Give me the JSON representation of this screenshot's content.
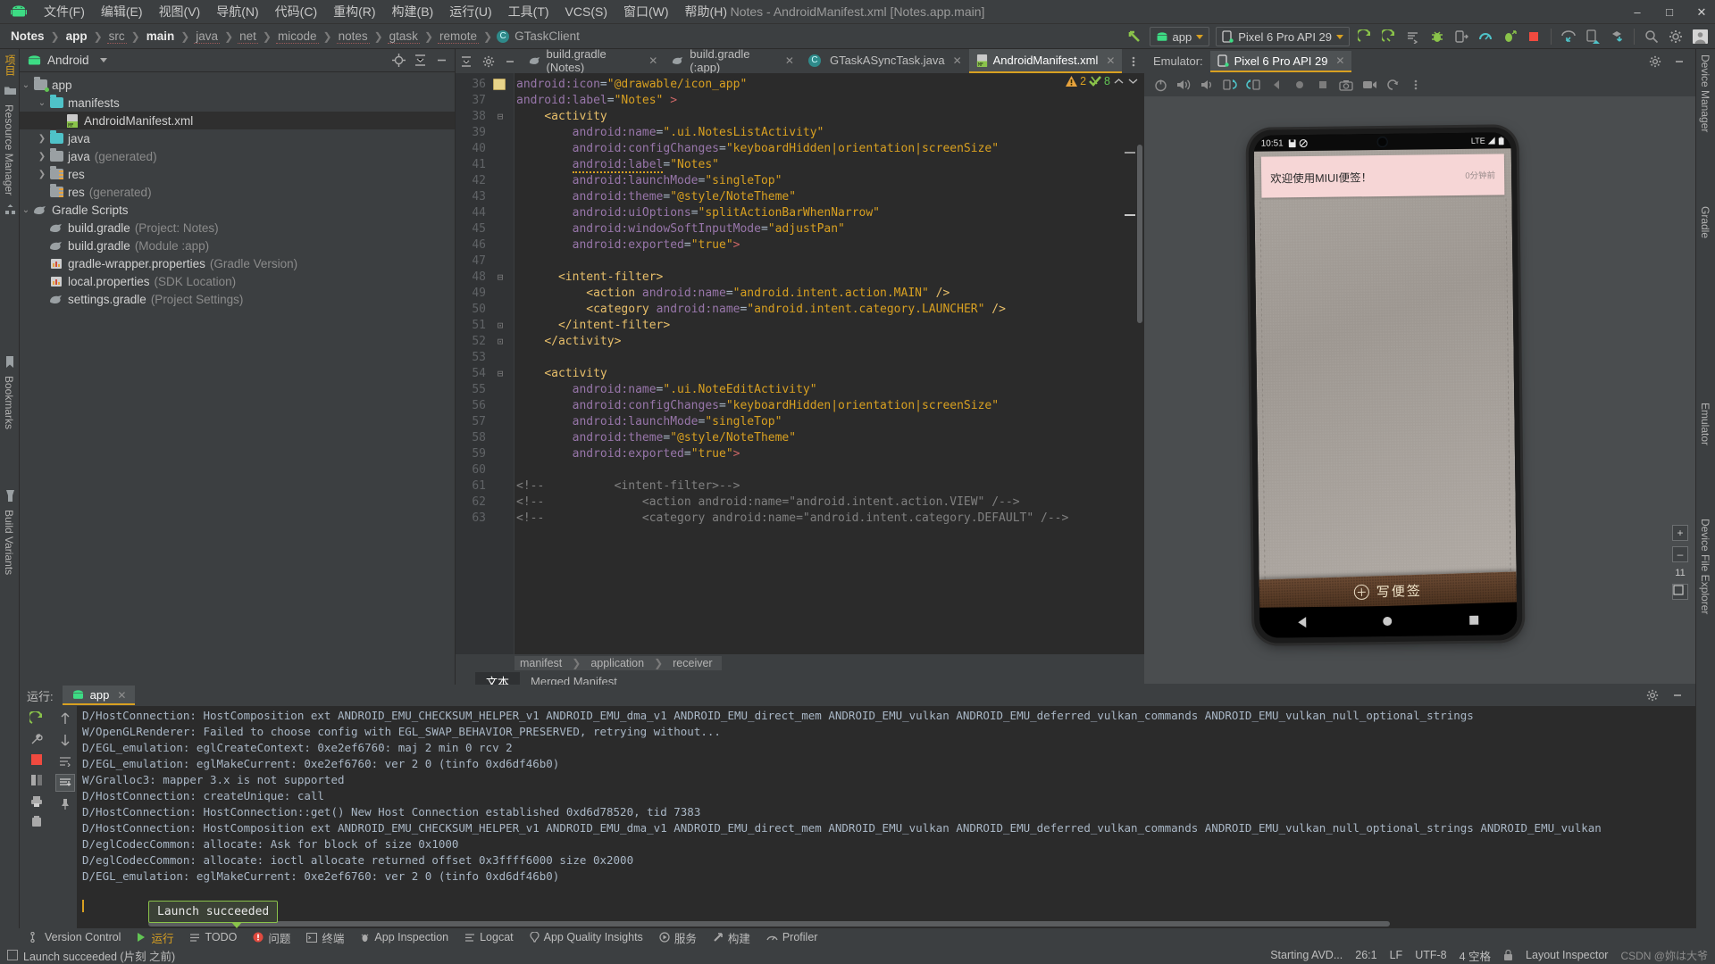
{
  "window": {
    "title": "Notes - AndroidManifest.xml [Notes.app.main]",
    "minimize": "–",
    "maximize": "□",
    "close": "✕"
  },
  "menubar": {
    "logo_icon": "android-logo-icon",
    "items": [
      "文件(F)",
      "编辑(E)",
      "视图(V)",
      "导航(N)",
      "代码(C)",
      "重构(R)",
      "构建(B)",
      "运行(U)",
      "工具(T)",
      "VCS(S)",
      "窗口(W)",
      "帮助(H)"
    ]
  },
  "navbar": {
    "crumbs": [
      {
        "label": "Notes",
        "bold": true
      },
      {
        "label": "app",
        "bold": true
      },
      {
        "label": "src",
        "bold": false
      },
      {
        "label": "main",
        "bold": true
      },
      {
        "label": "java",
        "bold": false
      },
      {
        "label": "net",
        "bold": false
      },
      {
        "label": "micode",
        "bold": false
      },
      {
        "label": "notes",
        "bold": false
      },
      {
        "label": "gtask",
        "bold": false
      },
      {
        "label": "remote",
        "bold": false
      }
    ],
    "final_crumb": "GTaskClient",
    "final_crumb_icon": "class-icon",
    "run_config": "app",
    "device_target": "Pixel 6 Pro API 29",
    "icons": [
      "build-arrow-icon",
      "run-icon",
      "run-coverage-icon",
      "attach-debugger-icon",
      "debug-icon",
      "profile-icon",
      "android-profiler-icon",
      "apply-changes-icon",
      "stop-icon",
      "device-manager-icon",
      "layout-inspector-icon",
      "sdk-download-icon",
      "search-icon",
      "settings-gear-icon",
      "account-avatar-icon"
    ]
  },
  "left_strip": {
    "tabs": [
      "项目",
      "Resource Manager"
    ],
    "icons": [
      "project-folder-icon",
      "resource-manager-icon",
      "structure-icon"
    ],
    "bottom_tabs": [
      "Bookmarks",
      "Build Variants"
    ]
  },
  "right_strip": {
    "tabs": [
      "Device Manager",
      "Gradle",
      "Emulator",
      "Device File Explorer"
    ]
  },
  "project_panel": {
    "title": "Android",
    "title_icon": "android-head-icon",
    "actions": [
      "locate-target-icon",
      "collapse-all-icon",
      "hide-icon"
    ],
    "tree": [
      {
        "depth": 0,
        "arrow": "open",
        "icon": "module-folder-icon",
        "label": "app",
        "sub": "",
        "selected": false
      },
      {
        "depth": 1,
        "arrow": "open",
        "icon": "folder-icon",
        "label": "manifests",
        "sub": "",
        "selected": false
      },
      {
        "depth": 2,
        "arrow": "none",
        "icon": "manifest-file-icon",
        "label": "AndroidManifest.xml",
        "sub": "",
        "selected": true
      },
      {
        "depth": 1,
        "arrow": "closed",
        "icon": "folder-icon",
        "label": "java",
        "sub": "",
        "selected": false
      },
      {
        "depth": 1,
        "arrow": "closed",
        "icon": "generated-folder-icon",
        "label": "java",
        "sub": "(generated)",
        "selected": false
      },
      {
        "depth": 1,
        "arrow": "closed",
        "icon": "res-folder-icon",
        "label": "res",
        "sub": "",
        "selected": false
      },
      {
        "depth": 1,
        "arrow": "none",
        "icon": "res-folder-icon",
        "label": "res",
        "sub": "(generated)",
        "selected": false
      },
      {
        "depth": 0,
        "arrow": "open",
        "icon": "gradle-icon",
        "label": "Gradle Scripts",
        "sub": "",
        "selected": false
      },
      {
        "depth": 1,
        "arrow": "none",
        "icon": "gradle-icon",
        "label": "build.gradle",
        "sub": "(Project: Notes)",
        "selected": false
      },
      {
        "depth": 1,
        "arrow": "none",
        "icon": "gradle-icon",
        "label": "build.gradle",
        "sub": "(Module :app)",
        "selected": false
      },
      {
        "depth": 1,
        "arrow": "none",
        "icon": "properties-icon",
        "label": "gradle-wrapper.properties",
        "sub": "(Gradle Version)",
        "selected": false
      },
      {
        "depth": 1,
        "arrow": "none",
        "icon": "properties-icon",
        "label": "local.properties",
        "sub": "(SDK Location)",
        "selected": false
      },
      {
        "depth": 1,
        "arrow": "none",
        "icon": "gradle-icon",
        "label": "settings.gradle",
        "sub": "(Project Settings)",
        "selected": false
      }
    ]
  },
  "editor": {
    "tools": [
      "collapse-icon",
      "settings-gear-icon",
      "hide-icon"
    ],
    "tabs": [
      {
        "label": "build.gradle (Notes)",
        "icon": "gradle-icon",
        "active": false,
        "closable": true
      },
      {
        "label": "build.gradle (:app)",
        "icon": "gradle-icon",
        "active": false,
        "closable": true
      },
      {
        "label": "GTaskASyncTask.java",
        "icon": "class-icon",
        "active": false,
        "closable": true
      },
      {
        "label": "AndroidManifest.xml",
        "icon": "manifest-file-icon",
        "active": true,
        "closable": true
      }
    ],
    "inspections": {
      "warning_count": "2",
      "ok_count": "8",
      "warning_icon": "warning-triangle-icon",
      "ok_icon": "inspection-ok-icon",
      "up_icon": "chevron-up-icon",
      "down_icon": "chevron-down-icon"
    },
    "lines": [
      {
        "num": "36",
        "fold": "",
        "bookmark": true,
        "html": "        <span class='k-attr'>android:icon</span><span class='k-eq'>=</span><span class='k-str'>\"@drawable/icon_app\"</span>"
      },
      {
        "num": "37",
        "fold": "",
        "html": "        <span class='k-attr'>android:label</span><span class='k-eq'>=</span><span class='k-str'>\"Notes\"</span> <span class='k-red'>&gt;</span>"
      },
      {
        "num": "38",
        "fold": "minus",
        "html": "    <span class='k-tagname'>&lt;activity</span>"
      },
      {
        "num": "39",
        "fold": "",
        "html": "        <span class='k-attr'>android:name</span><span class='k-eq'>=</span><span class='k-str'>\".ui.NotesListActivity\"</span>"
      },
      {
        "num": "40",
        "fold": "",
        "html": "        <span class='k-attr'>android:configChanges</span><span class='k-eq'>=</span><span class='k-str'>\"keyboardHidden|orientation|screenSize\"</span>"
      },
      {
        "num": "41",
        "fold": "",
        "html": "        <span class='k-attr squiggle'>android:label</span><span class='k-eq'>=</span><span class='k-str'>\"Notes\"</span>"
      },
      {
        "num": "42",
        "fold": "",
        "html": "        <span class='k-attr'>android:launchMode</span><span class='k-eq'>=</span><span class='k-str'>\"singleTop\"</span>"
      },
      {
        "num": "43",
        "fold": "",
        "html": "        <span class='k-attr'>android:theme</span><span class='k-eq'>=</span><span class='k-str'>\"@style/NoteTheme\"</span>"
      },
      {
        "num": "44",
        "fold": "",
        "html": "        <span class='k-attr'>android:uiOptions</span><span class='k-eq'>=</span><span class='k-str'>\"splitActionBarWhenNarrow\"</span>"
      },
      {
        "num": "45",
        "fold": "",
        "html": "        <span class='k-attr'>android:windowSoftInputMode</span><span class='k-eq'>=</span><span class='k-str'>\"adjustPan\"</span>"
      },
      {
        "num": "46",
        "fold": "",
        "html": "        <span class='k-attr'>android:exported</span><span class='k-eq'>=</span><span class='k-str'>\"true\"</span><span class='k-red'>&gt;</span>"
      },
      {
        "num": "47",
        "fold": "",
        "html": ""
      },
      {
        "num": "48",
        "fold": "minus",
        "html": "      <span class='k-tagname'>&lt;intent-filter&gt;</span>"
      },
      {
        "num": "49",
        "fold": "",
        "html": "          <span class='k-tagname'>&lt;action</span> <span class='k-attr'>android:name</span><span class='k-eq'>=</span><span class='k-str'>\"android.intent.action.MAIN\"</span> <span class='k-tagname'>/&gt;</span>"
      },
      {
        "num": "50",
        "fold": "",
        "html": "          <span class='k-tagname'>&lt;category</span> <span class='k-attr'>android:name</span><span class='k-eq'>=</span><span class='k-str'>\"android.intent.category.LAUNCHER\"</span> <span class='k-tagname'>/&gt;</span>"
      },
      {
        "num": "51",
        "fold": "plus",
        "html": "      <span class='k-tagname'>&lt;/intent-filter&gt;</span>"
      },
      {
        "num": "52",
        "fold": "plus",
        "html": "    <span class='k-tagname'>&lt;/activity&gt;</span>"
      },
      {
        "num": "53",
        "fold": "",
        "html": ""
      },
      {
        "num": "54",
        "fold": "minus",
        "html": "    <span class='k-tagname'>&lt;activity</span>"
      },
      {
        "num": "55",
        "fold": "",
        "html": "        <span class='k-attr'>android:name</span><span class='k-eq'>=</span><span class='k-str'>\".ui.NoteEditActivity\"</span>"
      },
      {
        "num": "56",
        "fold": "",
        "html": "        <span class='k-attr'>android:configChanges</span><span class='k-eq'>=</span><span class='k-str'>\"keyboardHidden|orientation|screenSize\"</span>"
      },
      {
        "num": "57",
        "fold": "",
        "html": "        <span class='k-attr'>android:launchMode</span><span class='k-eq'>=</span><span class='k-str'>\"singleTop\"</span>"
      },
      {
        "num": "58",
        "fold": "",
        "html": "        <span class='k-attr'>android:theme</span><span class='k-eq'>=</span><span class='k-str'>\"@style/NoteTheme\"</span>"
      },
      {
        "num": "59",
        "fold": "",
        "html": "        <span class='k-attr'>android:exported</span><span class='k-eq'>=</span><span class='k-str'>\"true\"</span><span class='k-red'>&gt;</span>"
      },
      {
        "num": "60",
        "fold": "",
        "html": ""
      },
      {
        "num": "61",
        "fold": "",
        "comment": true,
        "html": "<span class='k-cmt'>&lt;!--           &lt;intent-filter&gt;--&gt;</span>"
      },
      {
        "num": "62",
        "fold": "",
        "comment": true,
        "html": "<span class='k-cmt'>&lt;!--               &lt;action android:name=\"android.intent.action.VIEW\" /--&gt;</span>"
      },
      {
        "num": "63",
        "fold": "",
        "comment": true,
        "html": "<span class='k-cmt'>&lt;!--               &lt;category android:name=\"android.intent.category.DEFAULT\" /--&gt;</span>"
      }
    ],
    "xml_breadcrumb": [
      "manifest",
      "application",
      "receiver"
    ],
    "bottom_tabs": [
      {
        "label": "文本",
        "active": true
      },
      {
        "label": "Merged Manifest",
        "active": false
      }
    ]
  },
  "emulator": {
    "panel_label": "Emulator:",
    "tab_label": "Pixel 6 Pro API 29",
    "tab_icon": "device-icon",
    "toolbar_icons": [
      "power-icon",
      "volume-up-icon",
      "volume-down-icon",
      "rotate-left-icon",
      "rotate-right-icon",
      "back-icon",
      "home-icon",
      "overview-icon",
      "screenshot-camera-icon",
      "record-video-icon",
      "snapshot-icon",
      "more-vertical-icon"
    ],
    "zoom_in": "+",
    "zoom_out": "–",
    "zoom_value": "11",
    "fit_icon": "fit-to-screen-icon",
    "panel_actions": [
      "settings-gear-icon",
      "hide-icon"
    ],
    "phone": {
      "status_time": "10:51",
      "status_icons": [
        "save-icon",
        "dnd-icon"
      ],
      "status_right": "LTE",
      "status_right_icons": [
        "signal-icon",
        "battery-icon"
      ],
      "note": {
        "title": "欢迎使用MIUI便签！",
        "time": "0分钟前"
      },
      "footer_button": "写便签",
      "footer_icon": "plus-circle-icon",
      "nav_icons": [
        "nav-back-icon",
        "nav-home-icon",
        "nav-recents-icon"
      ]
    }
  },
  "console": {
    "label": "运行:",
    "tab_label": "app",
    "tab_icon": "android-logo-icon",
    "head_actions": [
      "settings-gear-icon",
      "hide-icon"
    ],
    "gutter_icons": [
      "rerun-icon",
      "stop-red-icon",
      "print-icon",
      "trash-icon",
      "pin-icon"
    ],
    "gutter2_icons": [
      "up-arrow-icon",
      "down-arrow-icon",
      "soft-wrap-icon",
      "scroll-to-end-icon"
    ],
    "lines": [
      "D/HostConnection: HostComposition ext ANDROID_EMU_CHECKSUM_HELPER_v1 ANDROID_EMU_dma_v1 ANDROID_EMU_direct_mem ANDROID_EMU_vulkan ANDROID_EMU_deferred_vulkan_commands ANDROID_EMU_vulkan_null_optional_strings",
      "W/OpenGLRenderer: Failed to choose config with EGL_SWAP_BEHAVIOR_PRESERVED, retrying without...",
      "D/EGL_emulation: eglCreateContext: 0xe2ef6760: maj 2 min 0 rcv 2",
      "D/EGL_emulation: eglMakeCurrent: 0xe2ef6760: ver 2 0 (tinfo 0xd6df46b0)",
      "W/Gralloc3: mapper 3.x is not supported",
      "D/HostConnection: createUnique: call",
      "D/HostConnection: HostConnection::get() New Host Connection established 0xd6d78520, tid 7383",
      "D/HostConnection: HostComposition ext ANDROID_EMU_CHECKSUM_HELPER_v1 ANDROID_EMU_dma_v1 ANDROID_EMU_direct_mem ANDROID_EMU_vulkan ANDROID_EMU_deferred_vulkan_commands ANDROID_EMU_vulkan_null_optional_strings ANDROID_EMU_vulkan",
      "D/eglCodecCommon: allocate: Ask for block of size 0x1000",
      "D/eglCodecCommon: allocate: ioctl allocate returned offset 0x3ffff6000 size 0x2000",
      "D/EGL_emulation: eglMakeCurrent: 0xe2ef6760: ver 2 0 (tinfo 0xd6df46b0)"
    ],
    "tooltip": "Launch succeeded"
  },
  "status_tabs": [
    {
      "label": "Version Control",
      "icon": "branch-icon",
      "active": false
    },
    {
      "label": "运行",
      "icon": "run-icon",
      "active": true
    },
    {
      "label": "TODO",
      "icon": "todo-icon",
      "active": false
    },
    {
      "label": "问题",
      "icon": "problems-icon",
      "active": false
    },
    {
      "label": "终端",
      "icon": "terminal-icon",
      "active": false
    },
    {
      "label": "App Inspection",
      "icon": "app-inspection-icon",
      "active": false
    },
    {
      "label": "Logcat",
      "icon": "logcat-icon",
      "active": false
    },
    {
      "label": "App Quality Insights",
      "icon": "quality-insights-icon",
      "active": false
    },
    {
      "label": "服务",
      "icon": "services-icon",
      "active": false
    },
    {
      "label": "构建",
      "icon": "build-icon",
      "active": false
    },
    {
      "label": "Profiler",
      "icon": "profiler-icon",
      "active": false
    }
  ],
  "statusbar": {
    "message": "Launch succeeded (片刻 之前)",
    "message_icon": "event-log-icon",
    "avd_status": "Starting AVD...",
    "caret": "26:1",
    "line_sep": "LF",
    "encoding": "UTF-8",
    "indent": "4 空格",
    "lock_icon": "lock-icon",
    "inspection_label": "Layout Inspector",
    "watermark": "CSDN @妳は大爷"
  }
}
